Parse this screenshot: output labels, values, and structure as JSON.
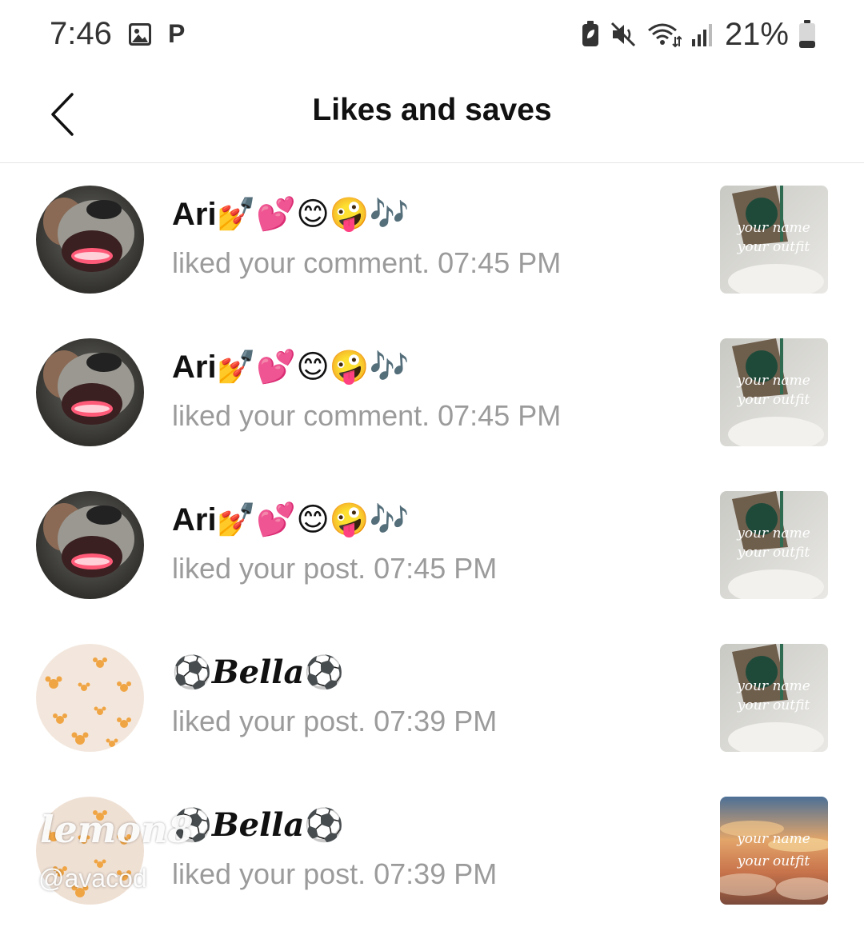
{
  "status_bar": {
    "time": "7:46",
    "notification_letter": "P",
    "battery_percent": "21%",
    "icons": [
      "gallery-icon",
      "battery-saver-icon",
      "mute-icon",
      "wifi-icon",
      "signal-icon",
      "battery-icon"
    ]
  },
  "header": {
    "title": "Likes and saves",
    "back_icon": "chevron-left-icon"
  },
  "notifications": [
    {
      "name": "Ari",
      "name_emojis": "💅💕😊🤪🎶",
      "action": "liked your comment. 07:45 PM",
      "avatar": "dog-photo",
      "thumbnail": "cup-photo"
    },
    {
      "name": "Ari",
      "name_emojis": "💅💕😊🤪🎶",
      "action": "liked your comment. 07:45 PM",
      "avatar": "dog-photo",
      "thumbnail": "cup-photo"
    },
    {
      "name": "Ari",
      "name_emojis": "💅💕😊🤪🎶",
      "action": "liked your post. 07:45 PM",
      "avatar": "dog-photo",
      "thumbnail": "cup-photo"
    },
    {
      "name": "Bella",
      "name_prefix": "⚽",
      "name_suffix": "⚽",
      "action": "liked your post. 07:39 PM",
      "avatar": "mouse-pattern",
      "thumbnail": "cup-photo"
    },
    {
      "name": "Bella",
      "name_prefix": "⚽",
      "name_suffix": "⚽",
      "action": "liked your post. 07:39 PM",
      "avatar": "mouse-pattern",
      "thumbnail": "sunset-photo"
    }
  ],
  "thumbnail_text": {
    "line1": "your name",
    "line2": "your outfit"
  },
  "watermark": {
    "logo": "lemon8",
    "handle": "@avacod"
  },
  "colors": {
    "primary_text": "#111111",
    "secondary_text": "#9b9b9b",
    "divider": "#e6e6e6"
  }
}
